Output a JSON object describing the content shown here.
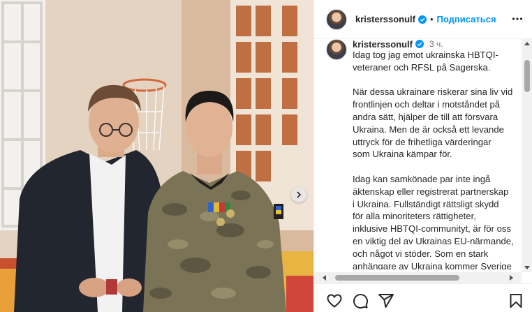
{
  "header": {
    "username": "kristerssonulf",
    "separator": "•",
    "follow_label": "Подписаться",
    "verified_icon": "verified-badge-icon",
    "more_icon": "more-options-icon"
  },
  "caption": {
    "username": "kristerssonulf",
    "time": "3 ч.",
    "paragraphs": [
      "Idag tog jag emot ukrainska HBTQI-\nveteraner och RFSL på Sagerska.",
      "När dessa ukrainare riskerar sina liv vid\nfrontlinjen och deltar i motståndet på\nandra sätt, hjälper de till att försvara\nUkraina. Men de är också ett levande\nuttryck för de frihetliga värderingar\nsom Ukraina kämpar för.",
      "Idag kan samkönade par inte ingå\näktenskap eller registrerat partnerskap\ni Ukraina. Fullständigt rättsligt skydd\nför alla minoriteters rättigheter,\ninklusive HBTQI-communityt, är för oss\nen viktig del av Ukrainas EU-närmande,\noch något vi stöder. Som en stark\nanhängare av Ukraina kommer Sverige\natt noggrant följa att detta uppfylls."
    ]
  },
  "actions": {
    "like_icon": "heart-icon",
    "comment_icon": "comment-icon",
    "share_icon": "share-icon",
    "save_icon": "bookmark-icon"
  },
  "photo": {
    "description_icon": "post-photo",
    "next_icon": "chevron-right-icon"
  },
  "colors": {
    "accent": "#0095f6",
    "text": "#262626",
    "muted": "#737373",
    "border": "#efefef"
  }
}
